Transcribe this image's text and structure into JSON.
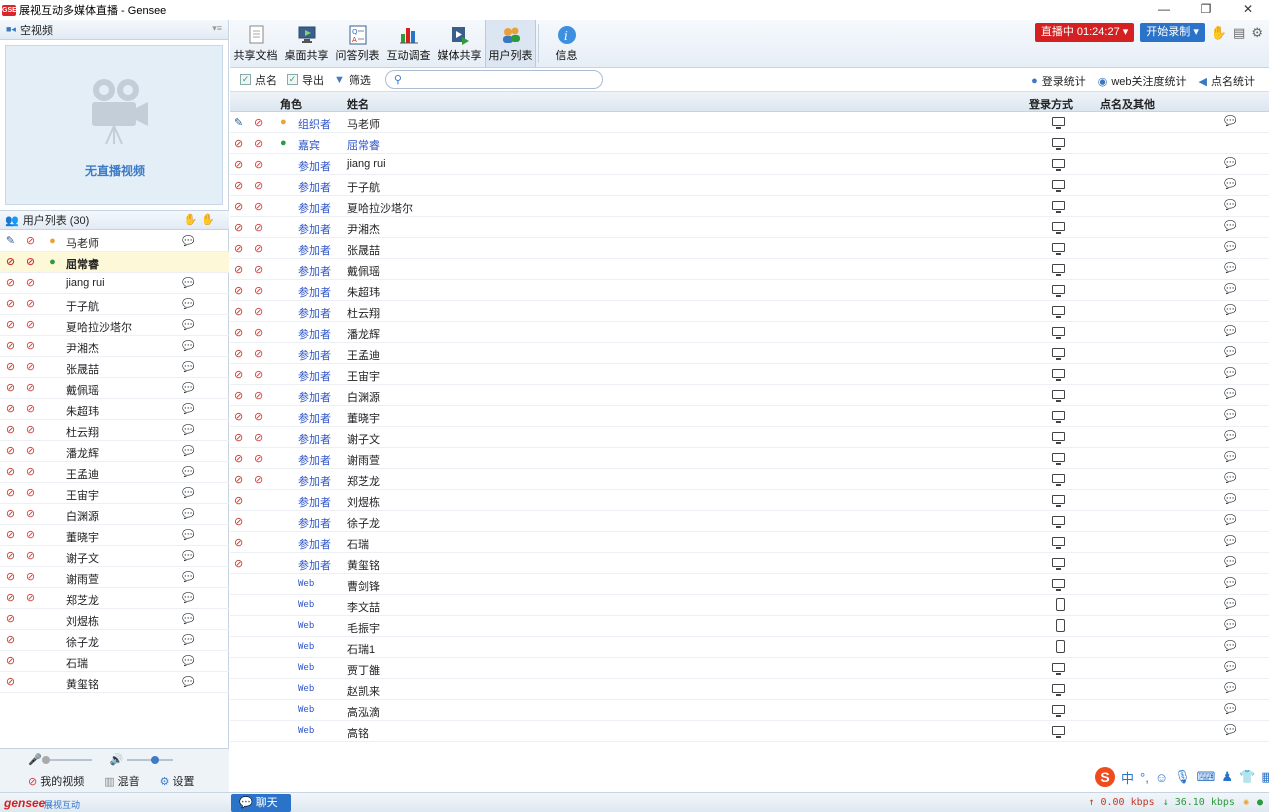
{
  "window": {
    "title": "展视互动多媒体直播 - Gensee",
    "app_icon": "GSE",
    "min": "—",
    "restore": "❐",
    "close": "✕"
  },
  "video_panel": {
    "header": "空视频",
    "no_video": "无直播视频"
  },
  "userlist_panel": {
    "header": "用户列表 (30)"
  },
  "left_footer": {
    "my_video": "我的视频",
    "mix": "混音",
    "settings": "设置"
  },
  "toolbar": {
    "items": [
      {
        "label": "共享文档",
        "icon": "document-icon"
      },
      {
        "label": "桌面共享",
        "icon": "desktop-share-icon"
      },
      {
        "label": "问答列表",
        "icon": "qa-list-icon"
      },
      {
        "label": "互动调查",
        "icon": "survey-chart-icon"
      },
      {
        "label": "媒体共享",
        "icon": "media-share-icon"
      },
      {
        "label": "用户列表",
        "icon": "user-list-icon"
      },
      {
        "label": "信息",
        "icon": "info-icon"
      }
    ],
    "live_label": "直播中 01:24:27 ▾",
    "record_label": "开始录制 ▾"
  },
  "subbar": {
    "rollcall": "点名",
    "export": "导出",
    "filter": "筛选",
    "search_placeholder": "",
    "login_stats": "登录统计",
    "web_stats": "web关注度统计",
    "rollcall_stats": "点名统计"
  },
  "table": {
    "headers": {
      "role": "角色",
      "name": "姓名",
      "login": "登录方式",
      "rollcall": "点名及其他"
    },
    "rows": [
      {
        "mic": "presenter",
        "cam": true,
        "roleicon": "organizer",
        "role": "组织者",
        "name": "马老师",
        "device": "pc",
        "chat": true
      },
      {
        "mic": "off",
        "cam": true,
        "roleicon": "guest",
        "role": "嘉宾",
        "name": "屈常睿",
        "device": "pc",
        "chat": false,
        "blue": true
      },
      {
        "mic": "off",
        "cam": true,
        "roleicon": "",
        "role": "参加者",
        "name": "jiang rui",
        "device": "pc",
        "chat": true
      },
      {
        "mic": "off",
        "cam": true,
        "roleicon": "",
        "role": "参加者",
        "name": "于子航",
        "device": "pc",
        "chat": true
      },
      {
        "mic": "off",
        "cam": true,
        "roleicon": "",
        "role": "参加者",
        "name": "夏哈拉沙塔尔",
        "device": "pc",
        "chat": true
      },
      {
        "mic": "off",
        "cam": true,
        "roleicon": "",
        "role": "参加者",
        "name": "尹湘杰",
        "device": "pc",
        "chat": true
      },
      {
        "mic": "off",
        "cam": true,
        "roleicon": "",
        "role": "参加者",
        "name": "张晟喆",
        "device": "pc",
        "chat": true
      },
      {
        "mic": "off",
        "cam": true,
        "roleicon": "",
        "role": "参加者",
        "name": "戴佩瑶",
        "device": "pc",
        "chat": true
      },
      {
        "mic": "off",
        "cam": true,
        "roleicon": "",
        "role": "参加者",
        "name": "朱超玮",
        "device": "pc",
        "chat": true
      },
      {
        "mic": "off",
        "cam": true,
        "roleicon": "",
        "role": "参加者",
        "name": "杜云翔",
        "device": "pc",
        "chat": true
      },
      {
        "mic": "off",
        "cam": true,
        "roleicon": "",
        "role": "参加者",
        "name": "潘龙辉",
        "device": "pc",
        "chat": true
      },
      {
        "mic": "off",
        "cam": true,
        "roleicon": "",
        "role": "参加者",
        "name": "王孟迪",
        "device": "pc",
        "chat": true
      },
      {
        "mic": "off",
        "cam": true,
        "roleicon": "",
        "role": "参加者",
        "name": "王宙宇",
        "device": "pc",
        "chat": true
      },
      {
        "mic": "off",
        "cam": true,
        "roleicon": "",
        "role": "参加者",
        "name": "白渊源",
        "device": "pc",
        "chat": true
      },
      {
        "mic": "off",
        "cam": true,
        "roleicon": "",
        "role": "参加者",
        "name": "董晓宇",
        "device": "pc",
        "chat": true
      },
      {
        "mic": "off",
        "cam": true,
        "roleicon": "",
        "role": "参加者",
        "name": "谢子文",
        "device": "pc",
        "chat": true
      },
      {
        "mic": "off",
        "cam": true,
        "roleicon": "",
        "role": "参加者",
        "name": "谢雨萱",
        "device": "pc",
        "chat": true
      },
      {
        "mic": "off",
        "cam": true,
        "roleicon": "",
        "role": "参加者",
        "name": "郑芝龙",
        "device": "pc",
        "chat": true
      },
      {
        "mic": "off",
        "cam": false,
        "roleicon": "",
        "role": "参加者",
        "name": "刘煜栋",
        "device": "pc",
        "chat": true
      },
      {
        "mic": "off",
        "cam": false,
        "roleicon": "",
        "role": "参加者",
        "name": "徐子龙",
        "device": "pc",
        "chat": true
      },
      {
        "mic": "off",
        "cam": false,
        "roleicon": "",
        "role": "参加者",
        "name": "石瑞",
        "device": "pc",
        "chat": true
      },
      {
        "mic": "off",
        "cam": false,
        "roleicon": "",
        "role": "参加者",
        "name": "黄玺铭",
        "device": "pc",
        "chat": true
      },
      {
        "mic": "",
        "cam": false,
        "roleicon": "",
        "role": "Web",
        "name": "曹剑锋",
        "device": "pc",
        "chat": true
      },
      {
        "mic": "",
        "cam": false,
        "roleicon": "",
        "role": "Web",
        "name": "李文喆",
        "device": "tablet",
        "chat": true
      },
      {
        "mic": "",
        "cam": false,
        "roleicon": "",
        "role": "Web",
        "name": "毛振宇",
        "device": "tablet",
        "chat": true
      },
      {
        "mic": "",
        "cam": false,
        "roleicon": "",
        "role": "Web",
        "name": "石瑞1",
        "device": "tablet",
        "chat": true
      },
      {
        "mic": "",
        "cam": false,
        "roleicon": "",
        "role": "Web",
        "name": "贾丁雒",
        "device": "pc",
        "chat": true
      },
      {
        "mic": "",
        "cam": false,
        "roleicon": "",
        "role": "Web",
        "name": "赵凯来",
        "device": "pc",
        "chat": true
      },
      {
        "mic": "",
        "cam": false,
        "roleicon": "",
        "role": "Web",
        "name": "高泓滴",
        "device": "pc",
        "chat": true
      },
      {
        "mic": "",
        "cam": false,
        "roleicon": "",
        "role": "Web",
        "name": "高铭",
        "device": "pc",
        "chat": true
      }
    ]
  },
  "left_users": [
    {
      "mic": "presenter",
      "cam": true,
      "roleicon": "organizer",
      "name": "马老师"
    },
    {
      "mic": "off",
      "cam": true,
      "roleicon": "guest",
      "name": "屈常睿",
      "selected": true
    },
    {
      "mic": "off",
      "cam": true,
      "roleicon": "",
      "name": "jiang rui"
    },
    {
      "mic": "off",
      "cam": true,
      "roleicon": "",
      "name": "于子航"
    },
    {
      "mic": "off",
      "cam": true,
      "roleicon": "",
      "name": "夏哈拉沙塔尔"
    },
    {
      "mic": "off",
      "cam": true,
      "roleicon": "",
      "name": "尹湘杰"
    },
    {
      "mic": "off",
      "cam": true,
      "roleicon": "",
      "name": "张晟喆"
    },
    {
      "mic": "off",
      "cam": true,
      "roleicon": "",
      "name": "戴佩瑶"
    },
    {
      "mic": "off",
      "cam": true,
      "roleicon": "",
      "name": "朱超玮"
    },
    {
      "mic": "off",
      "cam": true,
      "roleicon": "",
      "name": "杜云翔"
    },
    {
      "mic": "off",
      "cam": true,
      "roleicon": "",
      "name": "潘龙辉"
    },
    {
      "mic": "off",
      "cam": true,
      "roleicon": "",
      "name": "王孟迪"
    },
    {
      "mic": "off",
      "cam": true,
      "roleicon": "",
      "name": "王宙宇"
    },
    {
      "mic": "off",
      "cam": true,
      "roleicon": "",
      "name": "白渊源"
    },
    {
      "mic": "off",
      "cam": true,
      "roleicon": "",
      "name": "董晓宇"
    },
    {
      "mic": "off",
      "cam": true,
      "roleicon": "",
      "name": "谢子文"
    },
    {
      "mic": "off",
      "cam": true,
      "roleicon": "",
      "name": "谢雨萱"
    },
    {
      "mic": "off",
      "cam": true,
      "roleicon": "",
      "name": "郑芝龙"
    },
    {
      "mic": "off",
      "cam": false,
      "roleicon": "",
      "name": "刘煜栋"
    },
    {
      "mic": "off",
      "cam": false,
      "roleicon": "",
      "name": "徐子龙"
    },
    {
      "mic": "off",
      "cam": false,
      "roleicon": "",
      "name": "石瑞"
    },
    {
      "mic": "off",
      "cam": false,
      "roleicon": "",
      "name": "黄玺铭"
    }
  ],
  "statusbar": {
    "brand": "gensee",
    "brand_cn": "展视互动",
    "chat_tab": "聊天",
    "upload": "↑ 0.00 kbps",
    "download": "↓ 36.10 kbps"
  },
  "ime": {
    "label": "中"
  },
  "colors": {
    "accent": "#2b73c8",
    "live": "#d42020",
    "role_blue": "#2f55c8"
  }
}
